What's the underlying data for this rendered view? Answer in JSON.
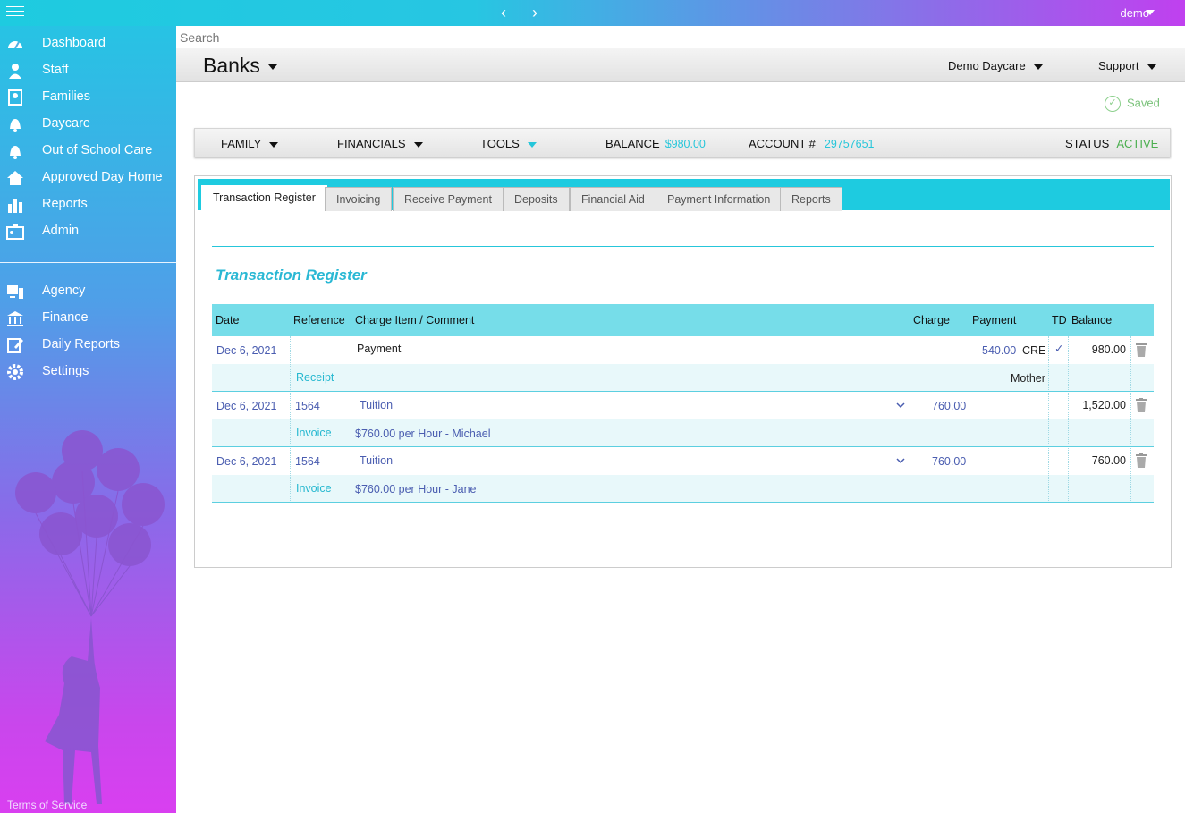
{
  "topbar": {
    "user": "demo",
    "nav_arrows": "‹ ›"
  },
  "sidebar": {
    "primary": [
      {
        "label": "Dashboard",
        "icon": "gauge-icon"
      },
      {
        "label": "Staff",
        "icon": "person-icon"
      },
      {
        "label": "Families",
        "icon": "families-icon"
      },
      {
        "label": "Daycare",
        "icon": "bell-icon"
      },
      {
        "label": "Out of School Care",
        "icon": "bell-icon"
      },
      {
        "label": "Approved Day Home",
        "icon": "home-icon"
      },
      {
        "label": "Reports",
        "icon": "bar-chart-icon"
      },
      {
        "label": "Admin",
        "icon": "id-card-icon"
      }
    ],
    "secondary": [
      {
        "label": "Agency",
        "icon": "monitor-icon"
      },
      {
        "label": "Finance",
        "icon": "bank-icon"
      },
      {
        "label": "Daily Reports",
        "icon": "edit-icon"
      },
      {
        "label": "Settings",
        "icon": "gear-icon"
      }
    ],
    "terms": "Terms of Service"
  },
  "search": {
    "placeholder": "Search"
  },
  "header": {
    "title": "Banks",
    "org": "Demo Daycare",
    "support": "Support"
  },
  "status": {
    "saved": "Saved"
  },
  "family_bar": {
    "family": "FAMILY",
    "financials": "FINANCIALS",
    "tools": "TOOLS",
    "balance_label": "BALANCE",
    "balance_value": "$980.00",
    "account_label": "ACCOUNT #",
    "account_value": "29757651",
    "status_label": "STATUS",
    "status_value": "ACTIVE"
  },
  "tabs": [
    "Transaction Register",
    "Invoicing",
    "Receive Payment",
    "Deposits",
    "Financial Aid",
    "Payment Information",
    "Reports"
  ],
  "register": {
    "title": "Transaction Register",
    "columns": [
      "Date",
      "Reference",
      "Charge Item / Comment",
      "Charge",
      "Payment",
      "TD",
      "Balance"
    ],
    "rows": [
      {
        "date": "Dec 6, 2021",
        "reference": "",
        "item": "Payment",
        "charge": "",
        "payment": "540.00",
        "payment_type": "CRE",
        "td": "✓",
        "balance": "980.00",
        "sub_reference": "Receipt",
        "sub_comment": "",
        "sub_payment": "Mother"
      },
      {
        "date": "Dec 6, 2021",
        "reference": "1564",
        "item": "Tuition",
        "charge": "760.00",
        "payment": "",
        "payment_type": "",
        "td": "",
        "balance": "1,520.00",
        "sub_reference": "Invoice",
        "sub_comment": "$760.00 per Hour  - Michael",
        "sub_payment": ""
      },
      {
        "date": "Dec 6, 2021",
        "reference": "1564",
        "item": "Tuition",
        "charge": "760.00",
        "payment": "",
        "payment_type": "",
        "td": "",
        "balance": "760.00",
        "sub_reference": "Invoice",
        "sub_comment": "$760.00 per Hour  - Jane",
        "sub_payment": ""
      }
    ]
  }
}
